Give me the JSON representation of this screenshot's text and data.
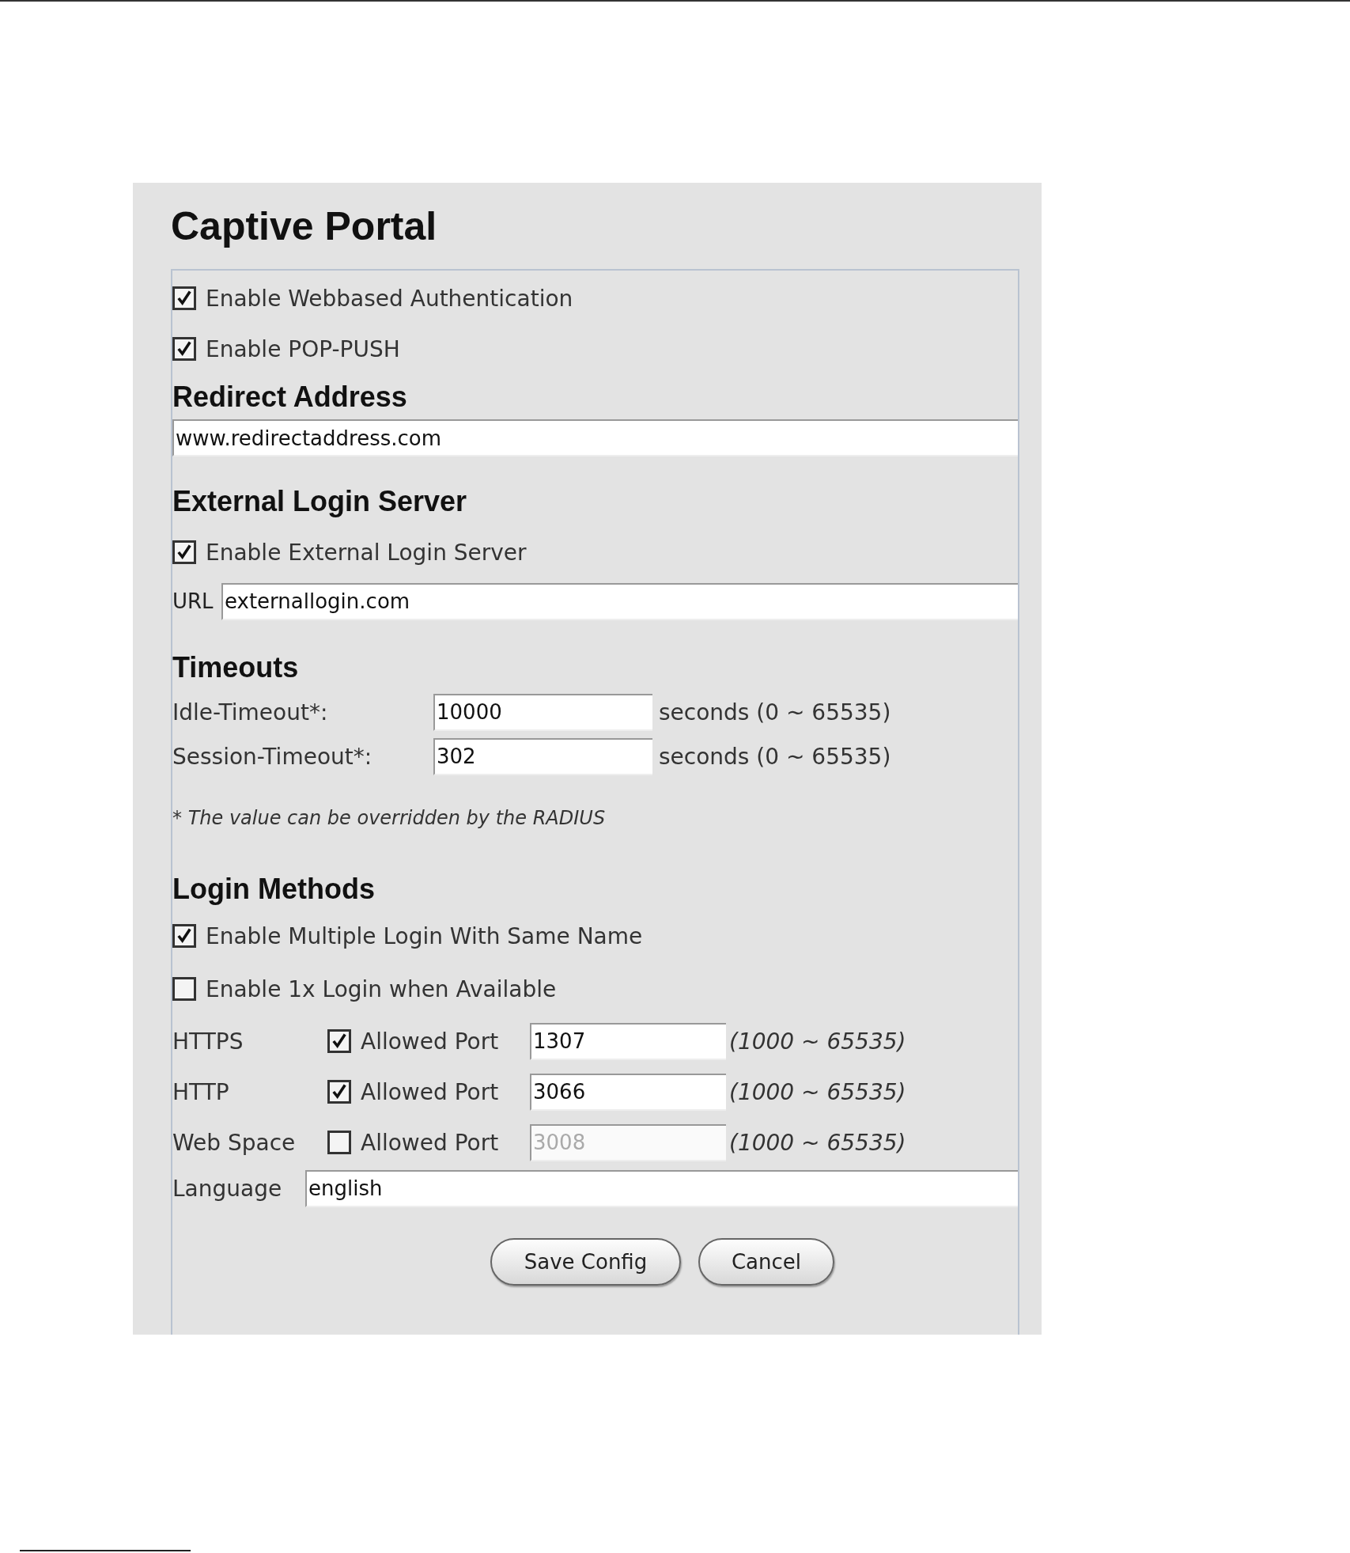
{
  "title": "Captive Portal",
  "general": [
    {
      "label": "Enable Webbased Authentication",
      "checked": true
    },
    {
      "label": "Enable POP-PUSH",
      "checked": true
    }
  ],
  "redirect": {
    "heading": "Redirect Address",
    "value": "www.redirectaddress.com"
  },
  "external": {
    "heading": "External Login Server",
    "option": {
      "label": "Enable External Login Server",
      "checked": true
    },
    "url_label": "URL",
    "url_value": "externallogin.com"
  },
  "timeouts": {
    "heading": "Timeouts",
    "rows": [
      {
        "label": "Idle-Timeout*:",
        "value": "10000",
        "unit": "seconds (0 ~ 65535)"
      },
      {
        "label": "Session-Timeout*:",
        "value": "302",
        "unit": "seconds (0 ~ 65535)"
      }
    ],
    "note": "* The value can be overridden by the RADIUS"
  },
  "login_methods": {
    "heading": "Login Methods",
    "options": [
      {
        "label": "Enable Multiple Login With Same Name",
        "checked": true
      },
      {
        "label": "Enable 1x Login when Available",
        "checked": false
      }
    ],
    "ports": [
      {
        "protocol": "HTTPS",
        "checked": true,
        "label": "Allowed Port",
        "value": "1307",
        "disabled": false,
        "range": "(1000 ~ 65535)"
      },
      {
        "protocol": "HTTP",
        "checked": true,
        "label": "Allowed Port",
        "value": "3066",
        "disabled": false,
        "range": "(1000 ~ 65535)"
      },
      {
        "protocol": "Web Space",
        "checked": false,
        "label": "Allowed Port",
        "value": "3008",
        "disabled": true,
        "range": "(1000 ~ 65535)"
      }
    ],
    "language_label": "Language",
    "language_value": "english"
  },
  "buttons": [
    "Save Config",
    "Cancel"
  ]
}
